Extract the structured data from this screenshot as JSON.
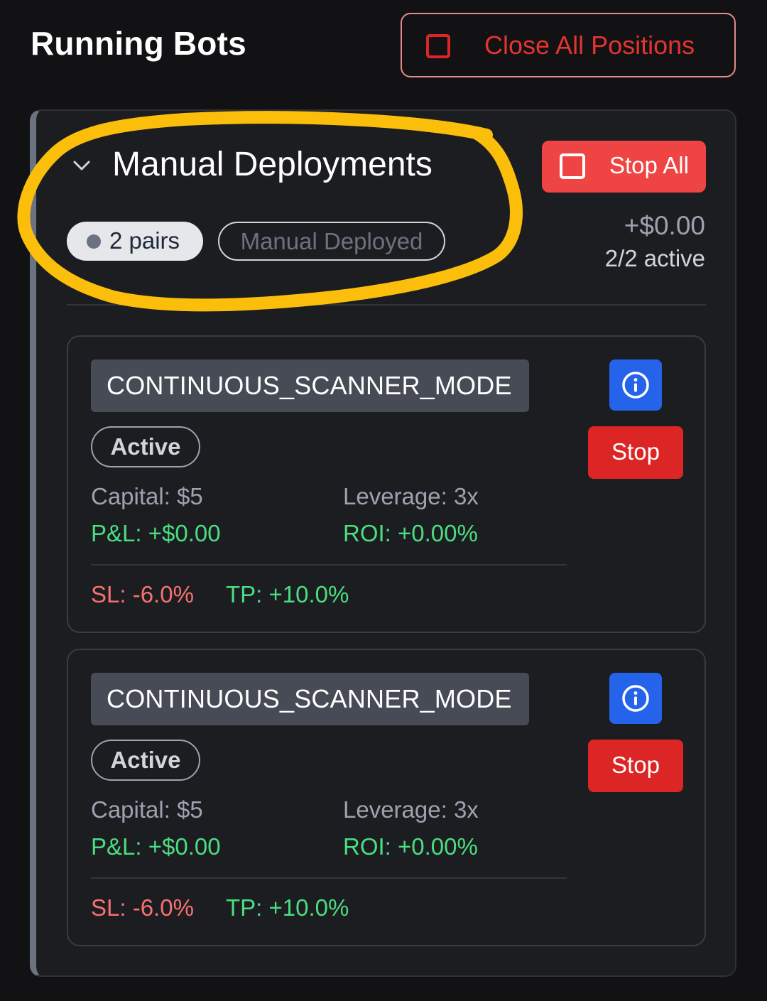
{
  "header": {
    "title": "Running Bots",
    "close_all_label": "Close All Positions"
  },
  "group": {
    "title": "Manual Deployments",
    "pairs_badge": "2 pairs",
    "type_badge": "Manual Deployed",
    "stop_all_label": "Stop All",
    "total_pnl": "+$0.00",
    "active_count": "2/2 active"
  },
  "bots": [
    {
      "mode": "CONTINUOUS_SCANNER_MODE",
      "status": "Active",
      "capital": "Capital: $5",
      "leverage": "Leverage: 3x",
      "pnl": "P&L: +$0.00",
      "roi": "ROI: +0.00%",
      "sl": "SL: -6.0%",
      "tp": "TP: +10.0%",
      "stop_label": "Stop"
    },
    {
      "mode": "CONTINUOUS_SCANNER_MODE",
      "status": "Active",
      "capital": "Capital: $5",
      "leverage": "Leverage: 3x",
      "pnl": "P&L: +$0.00",
      "roi": "ROI: +0.00%",
      "sl": "SL: -6.0%",
      "tp": "TP: +10.0%",
      "stop_label": "Stop"
    }
  ],
  "icons": {
    "close_all": "square-stop-icon",
    "stop_all": "square-stop-icon",
    "collapse": "chevron-down-icon",
    "info": "info-circle-icon"
  },
  "colors": {
    "background": "#121214",
    "danger": "#dc2626",
    "stop_all": "#ef4444",
    "info": "#2563eb",
    "positive": "#4ade80",
    "negative": "#f87171",
    "highlight": "#fbbf0b"
  }
}
